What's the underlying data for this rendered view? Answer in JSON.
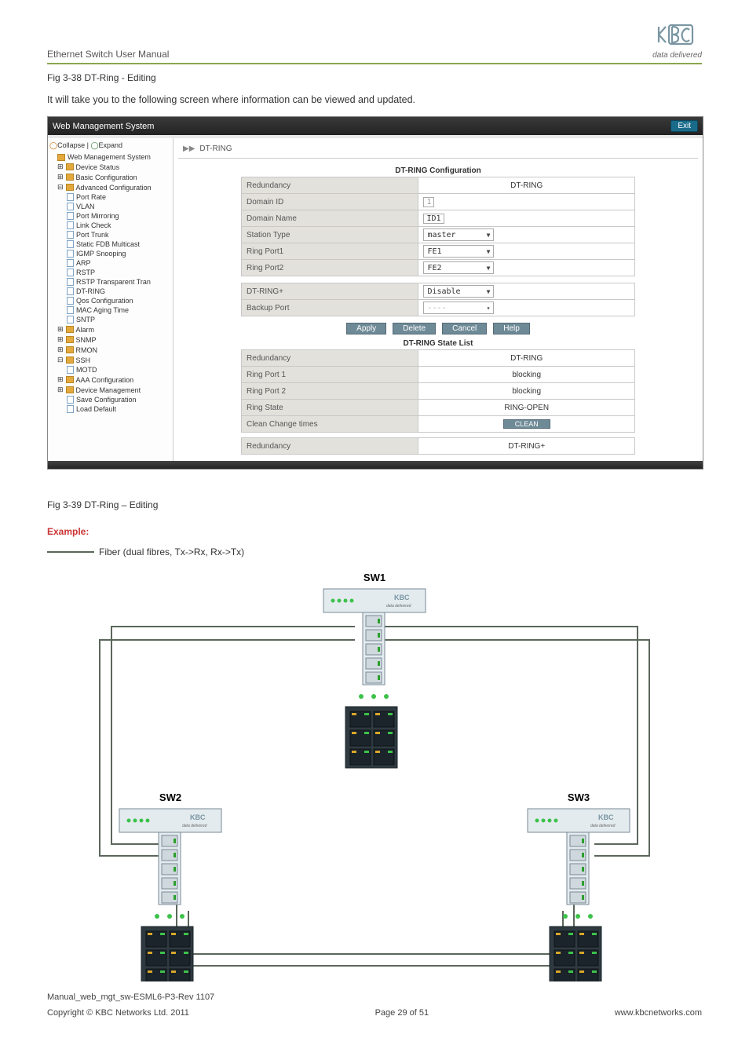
{
  "header": {
    "manual_title": "Ethernet Switch User Manual",
    "logo_tagline": "data delivered"
  },
  "captions": {
    "fig38": "Fig 3-38 DT-Ring - Editing",
    "lead": "It will take you to the following screen where information can be viewed and updated.",
    "fig39": "Fig 3-39 DT-Ring – Editing"
  },
  "screenshot": {
    "titlebar": "Web Management System",
    "exit": "Exit",
    "tree": {
      "collapse": "Collapse",
      "expand": "Expand",
      "root": "Web Management System",
      "folders": {
        "device_status": "Device Status",
        "basic": "Basic Configuration",
        "advanced": "Advanced Configuration",
        "alarm": "Alarm",
        "snmp": "SNMP",
        "rmon": "RMON",
        "ssh": "SSH",
        "aaa": "AAA Configuration",
        "device_mgmt": "Device Management"
      },
      "leaves": {
        "port_rate": "Port Rate",
        "vlan": "VLAN",
        "port_mirroring": "Port Mirroring",
        "link_check": "Link Check",
        "port_trunk": "Port Trunk",
        "static_fdb": "Static FDB Multicast",
        "igmp": "IGMP Snooping",
        "arp": "ARP",
        "rstp": "RSTP",
        "rstp_trans": "RSTP Transparent Tran",
        "dt_ring": "DT-RING",
        "qos": "Qos Configuration",
        "mac_aging": "MAC Aging Time",
        "sntp": "SNTP",
        "motd": "MOTD",
        "save_cfg": "Save Configuration",
        "load_default": "Load Default"
      }
    },
    "crumb": "DT-RING",
    "cfg": {
      "header": "DT-RING Configuration",
      "rows": {
        "redundancy_label": "Redundancy",
        "redundancy_value": "DT-RING",
        "domain_id_label": "Domain ID",
        "domain_id_value": "1",
        "domain_name_label": "Domain Name",
        "domain_name_value": "ID1",
        "station_type_label": "Station Type",
        "station_type_value": "master",
        "ring_port1_label": "Ring Port1",
        "ring_port1_value": "FE1",
        "ring_port2_label": "Ring Port2",
        "ring_port2_value": "FE2",
        "dtringplus_label": "DT-RING+",
        "dtringplus_value": "Disable",
        "backup_port_label": "Backup Port",
        "backup_port_value": "----"
      }
    },
    "buttons": {
      "apply": "Apply",
      "delete": "Delete",
      "cancel": "Cancel",
      "help": "Help"
    },
    "state": {
      "header": "DT-RING State List",
      "rows": {
        "redundancy_label": "Redundancy",
        "redundancy_value": "DT-RING",
        "ring_port1_label": "Ring Port 1",
        "ring_port1_value": "blocking",
        "ring_port2_label": "Ring Port 2",
        "ring_port2_value": "blocking",
        "ring_state_label": "Ring State",
        "ring_state_value": "RING-OPEN",
        "clean_change_label": "Clean Change times",
        "clean_button": "CLEAN",
        "footer_redundancy_label": "Redundancy",
        "footer_redundancy_value": "DT-RING+"
      }
    }
  },
  "example": {
    "heading": "Example:",
    "legend": "Fiber (dual fibres, Tx->Rx, Rx->Tx)",
    "sw1": "SW1",
    "sw2": "SW2",
    "sw3": "SW3",
    "dd": "data delivered"
  },
  "footer": {
    "filename": "Manual_web_mgt_sw-ESML6-P3-Rev 1107",
    "copyright": "Copyright © KBC Networks Ltd. 2011",
    "page": "Page 29 of 51",
    "url": "www.kbcnetworks.com"
  }
}
